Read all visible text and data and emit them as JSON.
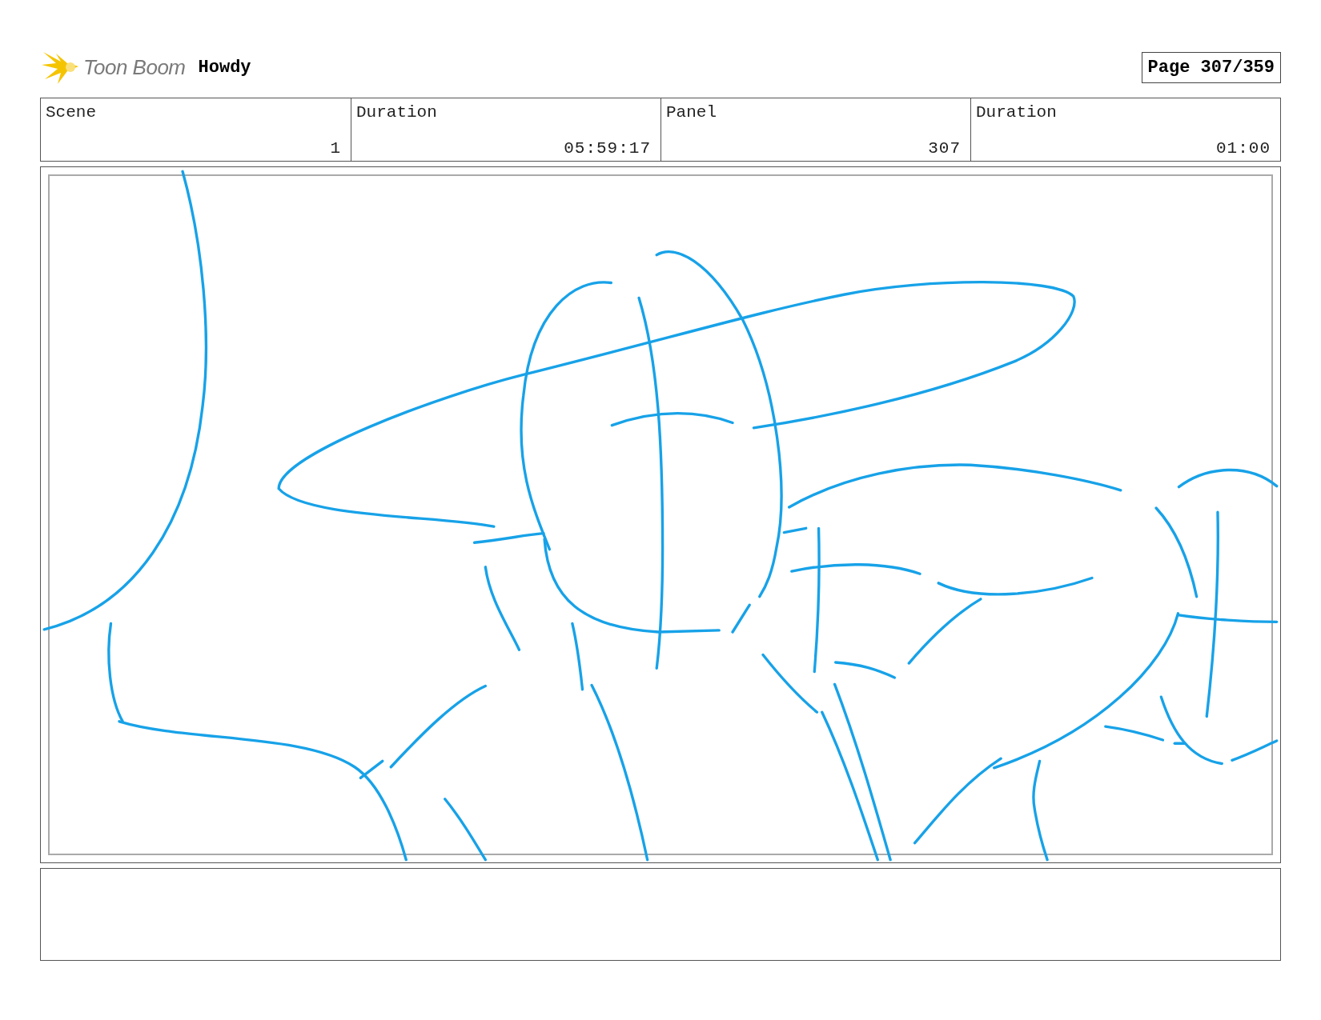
{
  "header": {
    "logo_text": "Toon Boom",
    "project_title": "Howdy",
    "page_label": "Page 307/359"
  },
  "info": [
    {
      "label": "Scene",
      "value": "1"
    },
    {
      "label": "Duration",
      "value": "05:59:17"
    },
    {
      "label": "Panel",
      "value": "307"
    },
    {
      "label": "Duration",
      "value": "01:00"
    }
  ]
}
